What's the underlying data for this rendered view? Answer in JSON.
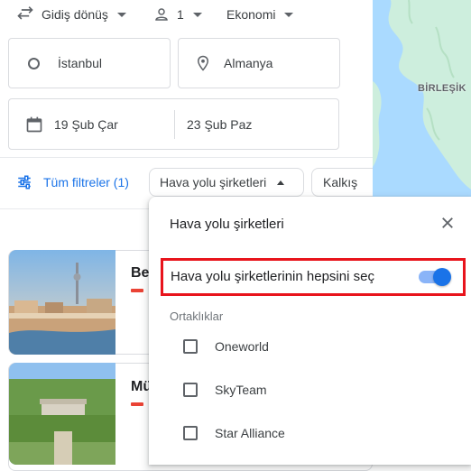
{
  "trip": {
    "trip_type": "Gidiş dönüş",
    "passengers": "1",
    "cabin_class": "Ekonomi"
  },
  "search": {
    "origin": "İstanbul",
    "destination": "Almanya",
    "depart_date": "19 Şub Çar",
    "return_date": "23 Şub Paz"
  },
  "filters": {
    "all_filters": "Tüm filtreler (1)",
    "airlines_chip": "Hava yolu şirketleri",
    "next_chip": "Kalkış"
  },
  "map": {
    "label": "BİRLEŞİK"
  },
  "results": [
    {
      "title": "Ber"
    },
    {
      "title": "Mü"
    }
  ],
  "popup": {
    "title": "Hava yolu şirketleri",
    "select_all_label": "Hava yolu şirketlerinin hepsini seç",
    "select_all_on": true,
    "section_label": "Ortaklıklar",
    "alliances": [
      "Oneworld",
      "SkyTeam",
      "Star Alliance"
    ]
  },
  "colors": {
    "accent": "#1a73e8",
    "highlight": "#e8141c",
    "map_water": "#aadaff",
    "map_land": "#cdeedd"
  }
}
